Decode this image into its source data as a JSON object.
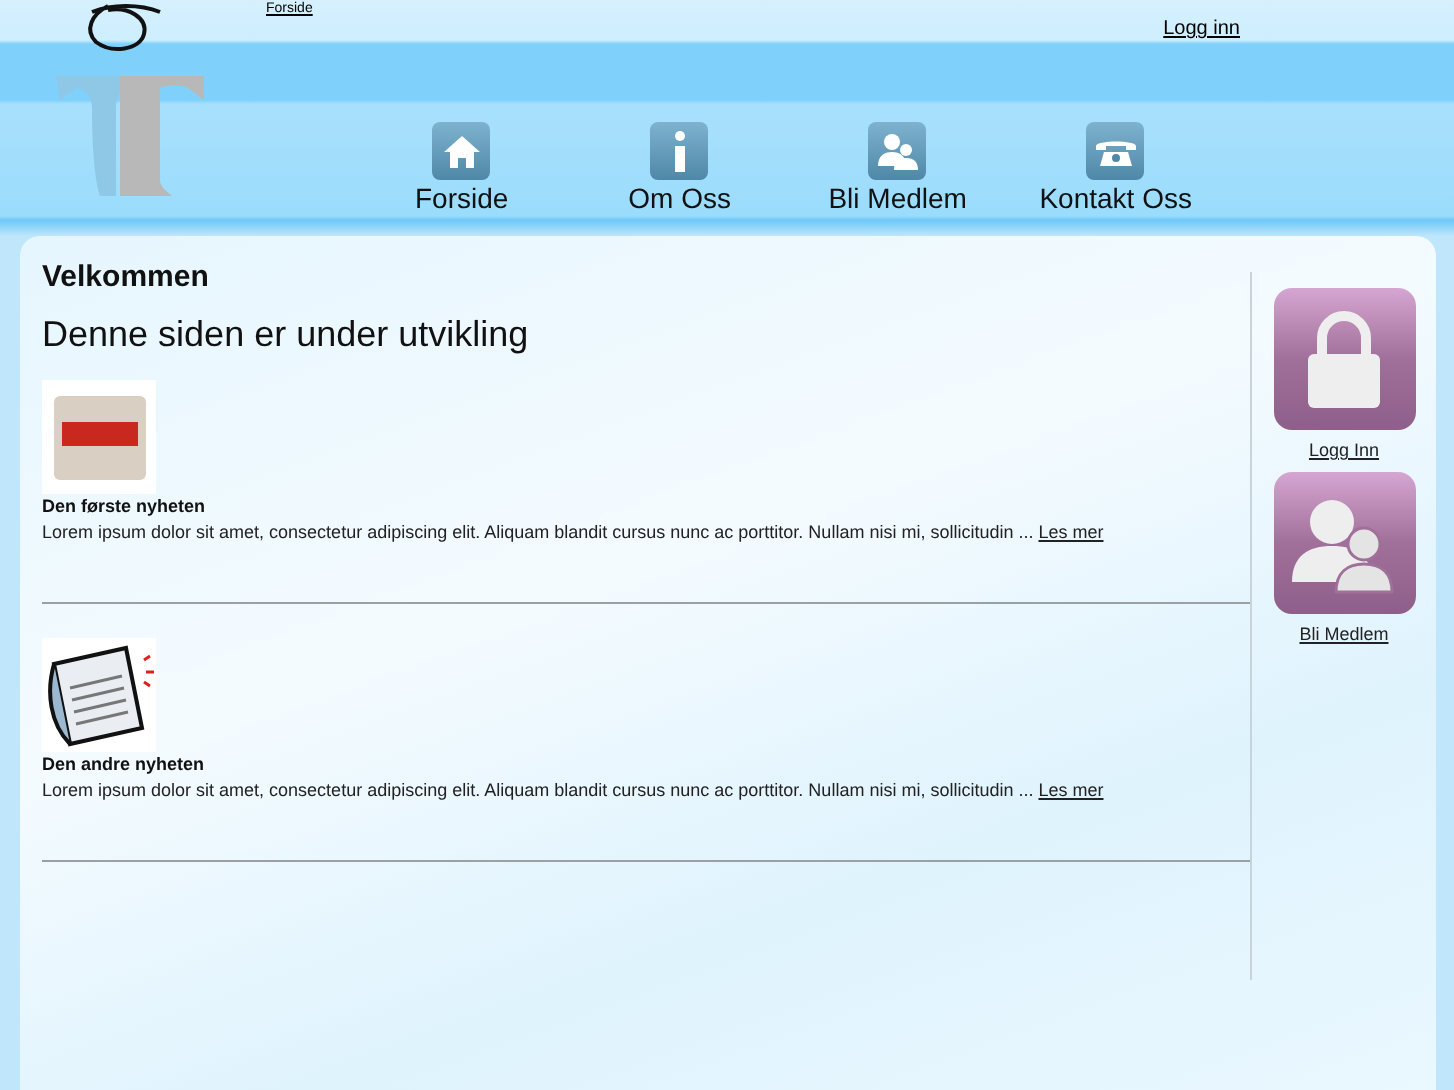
{
  "top_link": "Forside",
  "login_link": "Logg inn",
  "nav": [
    {
      "label": "Forside",
      "kind": "home"
    },
    {
      "label": "Om Oss",
      "kind": "info"
    },
    {
      "label": "Bli Medlem",
      "kind": "member"
    },
    {
      "label": "Kontakt Oss",
      "kind": "phone"
    }
  ],
  "page_title": "Velkommen",
  "heading": "Denne siden er under utvikling",
  "news": [
    {
      "kind": "stack",
      "title": "Den første nyheten",
      "text": "Lorem ipsum dolor sit amet, consectetur adipiscing elit. Aliquam blandit cursus nunc ac porttitor. Nullam nisi mi, sollicitudin ...",
      "link": "Les mer"
    },
    {
      "kind": "paper",
      "title": "Den andre nyheten",
      "text": "Lorem ipsum dolor sit amet, consectetur adipiscing elit. Aliquam blandit cursus nunc ac porttitor. Nullam nisi mi, sollicitudin ...",
      "link": "Les mer"
    }
  ],
  "sidebar": [
    {
      "kind": "lock",
      "label": "Logg Inn"
    },
    {
      "kind": "people",
      "label": "Bli Medlem"
    }
  ]
}
